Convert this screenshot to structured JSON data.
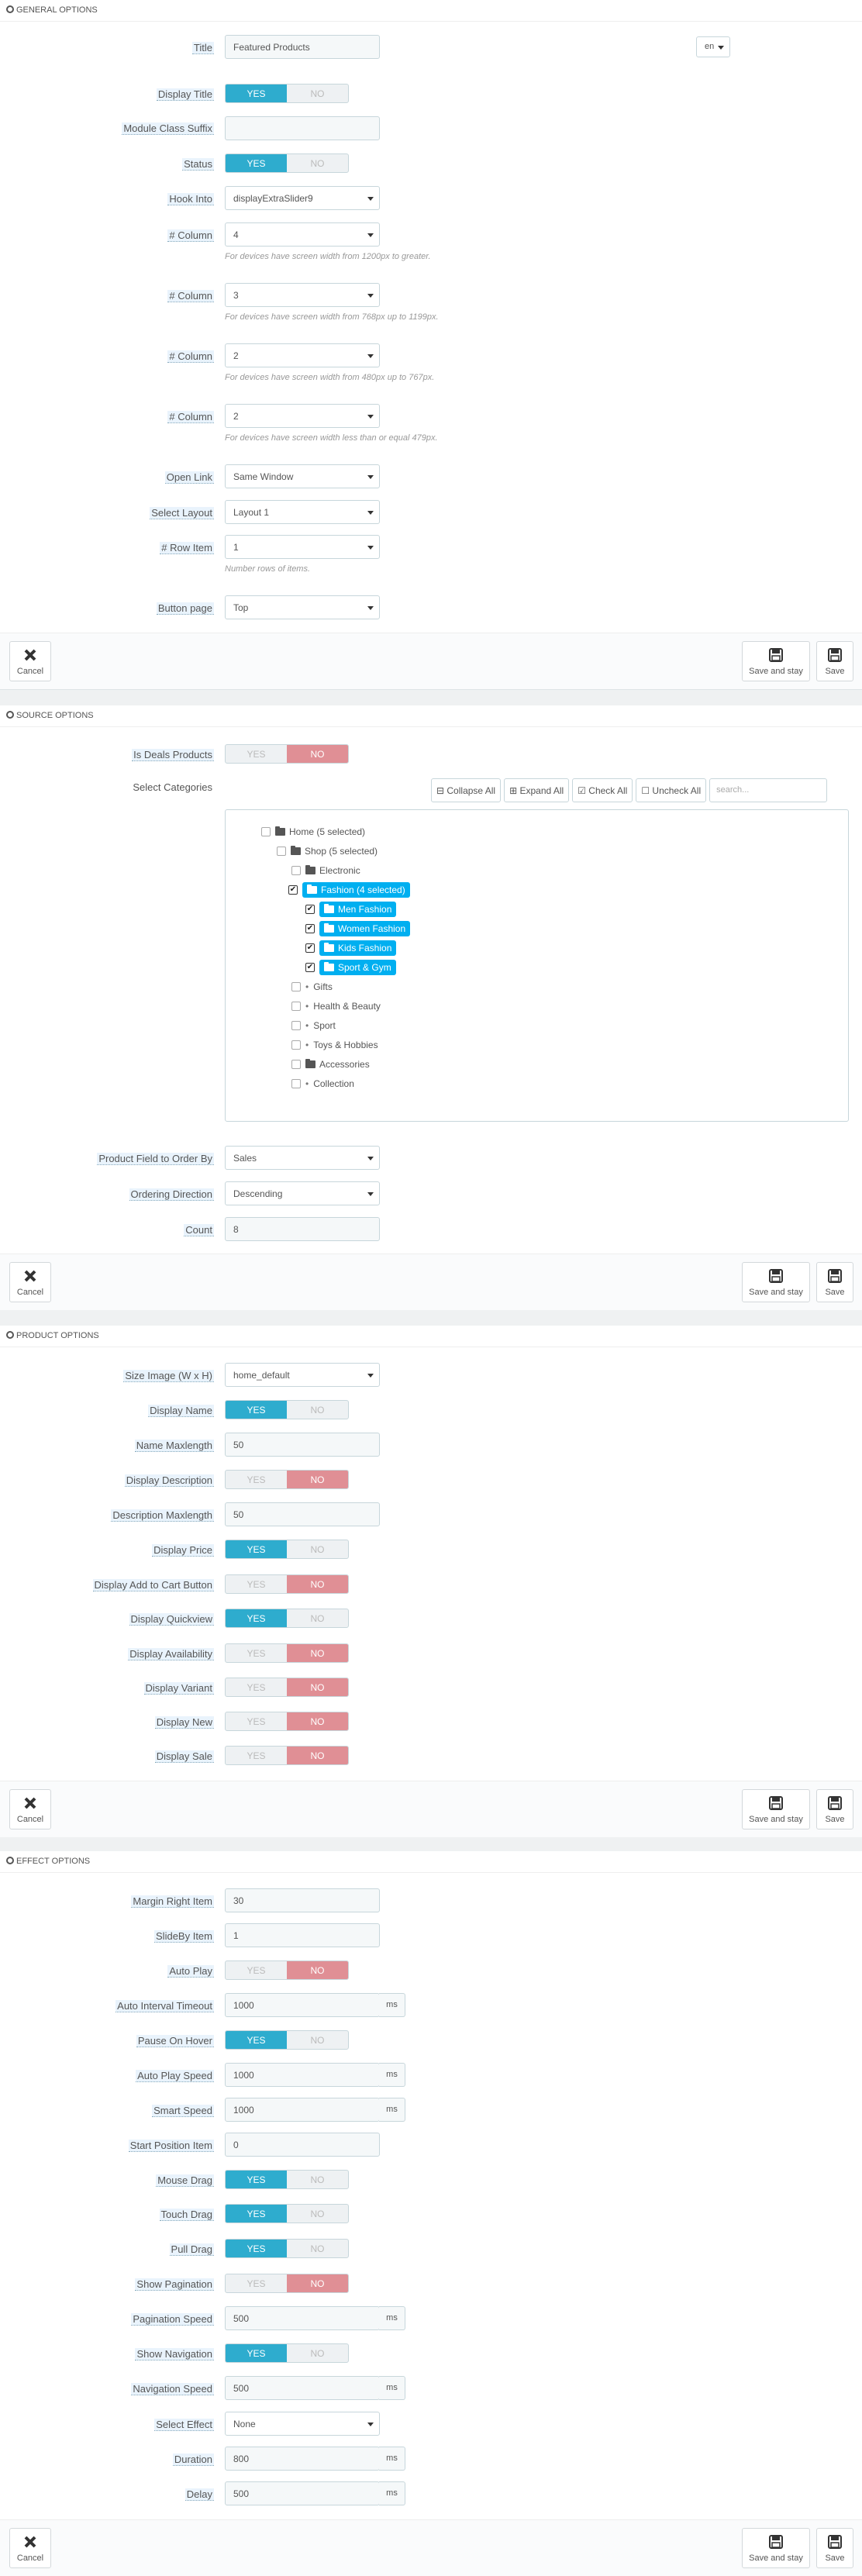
{
  "common": {
    "yes": "YES",
    "no": "NO",
    "ms": "ms",
    "cancel": "Cancel",
    "save_and_stay": "Save and stay",
    "save": "Save"
  },
  "general": {
    "heading": "GENERAL OPTIONS",
    "title_label": "Title",
    "title_value": "Featured Products",
    "lang": "en",
    "display_title_label": "Display Title",
    "display_title": "yes",
    "module_class_suffix_label": "Module Class Suffix",
    "module_class_suffix_value": "",
    "status_label": "Status",
    "status": "yes",
    "hook_into_label": "Hook Into",
    "hook_into_value": "displayExtraSlider9",
    "column_label": "# Column",
    "columns": [
      {
        "value": "4",
        "help": "For devices have screen width from 1200px to greater."
      },
      {
        "value": "3",
        "help": "For devices have screen width from 768px up to 1199px."
      },
      {
        "value": "2",
        "help": "For devices have screen width from 480px up to 767px."
      },
      {
        "value": "2",
        "help": "For devices have screen width less than or equal 479px."
      }
    ],
    "open_link_label": "Open Link",
    "open_link_value": "Same Window",
    "select_layout_label": "Select Layout",
    "select_layout_value": "Layout 1",
    "row_item_label": "# Row Item",
    "row_item_value": "1",
    "row_item_help": "Number rows of items.",
    "button_page_label": "Button page",
    "button_page_value": "Top"
  },
  "source": {
    "heading": "SOURCE OPTIONS",
    "is_deals_label": "Is Deals Products",
    "is_deals": "no",
    "select_categories_label": "Select Categories",
    "collapse_all": "Collapse All",
    "expand_all": "Expand All",
    "check_all": "Check All",
    "uncheck_all": "Uncheck All",
    "search_placeholder": "search...",
    "tree": {
      "home": "Home (5 selected)",
      "shop": "Shop (5 selected)",
      "electronic": "Electronic",
      "fashion": "Fashion (4 selected)",
      "men": "Men Fashion",
      "women": "Women Fashion",
      "kids": "Kids Fashion",
      "sport_gym": "Sport & Gym",
      "gifts": "Gifts",
      "health": "Health & Beauty",
      "sport": "Sport",
      "toys": "Toys & Hobbies",
      "accessories": "Accessories",
      "collection": "Collection"
    },
    "order_by_label": "Product Field to Order By",
    "order_by_value": "Sales",
    "direction_label": "Ordering Direction",
    "direction_value": "Descending",
    "count_label": "Count",
    "count_value": "8"
  },
  "product": {
    "heading": "PRODUCT OPTIONS",
    "size_image_label": "Size Image (W x H)",
    "size_image_value": "home_default",
    "display_name_label": "Display Name",
    "display_name": "yes",
    "name_max_label": "Name Maxlength",
    "name_max_value": "50",
    "display_desc_label": "Display Description",
    "display_desc": "no",
    "desc_max_label": "Description Maxlength",
    "desc_max_value": "50",
    "display_price_label": "Display Price",
    "display_price": "yes",
    "display_cart_label": "Display Add to Cart Button",
    "display_cart": "no",
    "display_quickview_label": "Display Quickview",
    "display_quickview": "yes",
    "display_availability_label": "Display Availability",
    "display_availability": "no",
    "display_variant_label": "Display Variant",
    "display_variant": "no",
    "display_new_label": "Display New",
    "display_new": "no",
    "display_sale_label": "Display Sale",
    "display_sale": "no"
  },
  "effect": {
    "heading": "EFFECT OPTIONS",
    "margin_right_label": "Margin Right Item",
    "margin_right_value": "30",
    "slideby_label": "SlideBy Item",
    "slideby_value": "1",
    "auto_play_label": "Auto Play",
    "auto_play": "no",
    "auto_interval_label": "Auto Interval Timeout",
    "auto_interval_value": "1000",
    "pause_hover_label": "Pause On Hover",
    "pause_hover": "yes",
    "auto_play_speed_label": "Auto Play Speed",
    "auto_play_speed_value": "1000",
    "smart_speed_label": "Smart Speed",
    "smart_speed_value": "1000",
    "start_position_label": "Start Position Item",
    "start_position_value": "0",
    "mouse_drag_label": "Mouse Drag",
    "mouse_drag": "yes",
    "touch_drag_label": "Touch Drag",
    "touch_drag": "yes",
    "pull_drag_label": "Pull Drag",
    "pull_drag": "yes",
    "show_pagination_label": "Show Pagination",
    "show_pagination": "no",
    "pagination_speed_label": "Pagination Speed",
    "pagination_speed_value": "500",
    "show_navigation_label": "Show Navigation",
    "show_navigation": "yes",
    "navigation_speed_label": "Navigation Speed",
    "navigation_speed_value": "500",
    "select_effect_label": "Select Effect",
    "select_effect_value": "None",
    "duration_label": "Duration",
    "duration_value": "800",
    "delay_label": "Delay",
    "delay_value": "500"
  },
  "colors": {
    "yes_on": "#2eacce",
    "no_on": "#e08f95",
    "selected_node": "#00aff0"
  }
}
